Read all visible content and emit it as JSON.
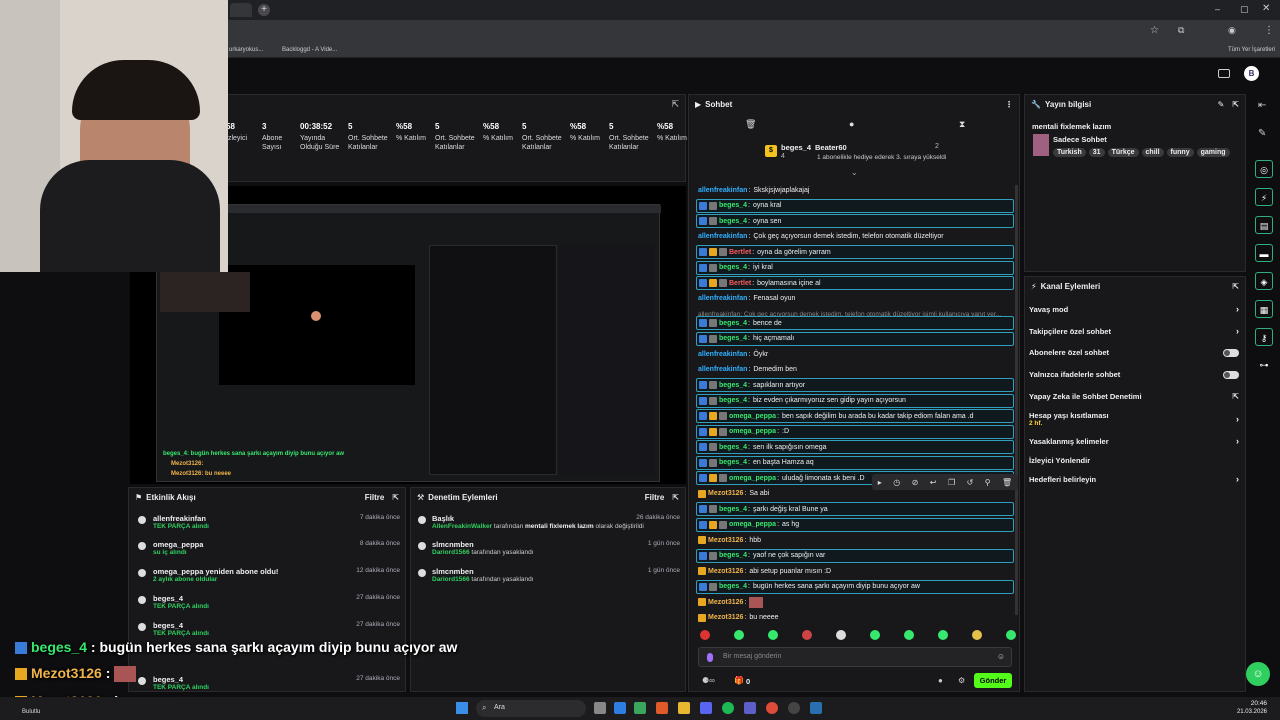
{
  "browser": {
    "tabs": [
      "Backloggd - A Vide..."
    ],
    "bookmark_partial": "Tüm Yer İşaretleri",
    "bookmark_left": "urkaryokus..."
  },
  "stats": [
    {
      "v": "58",
      "l": "İzleyici"
    },
    {
      "v": "3",
      "l": "Abone Sayısı"
    },
    {
      "v": "00:38:52",
      "l": "Yayında Olduğu Süre"
    },
    {
      "v": "5",
      "l": "Ort. Sohbete Katılanlar"
    },
    {
      "v": "%58",
      "l": "% Katılım"
    },
    {
      "v": "5",
      "l": "Ort. Sohbete Katılanlar"
    },
    {
      "v": "%58",
      "l": "% Katılım"
    },
    {
      "v": "5",
      "l": "Ort. Sohbete Katılanlar"
    },
    {
      "v": "%58",
      "l": "% Katılım"
    },
    {
      "v": "5",
      "l": "Ort. Sohbete Katılanlar"
    },
    {
      "v": "%58",
      "l": "% Katılım"
    }
  ],
  "chat": {
    "title": "Sohbet",
    "pinned_user": "beges_4",
    "pinned_count": "4",
    "pinned_gifter": "Beater60",
    "pinned_gift_count": "2",
    "pinned_note": "1 aboneliklе hediye ederek 3. sıraya yükseldi",
    "messages": [
      {
        "u": "allenfreakinfan",
        "m": "Skskjsjwjaplakajaj",
        "c": "#2fb0ff",
        "hl": false,
        "b": []
      },
      {
        "u": "beges_4",
        "m": "oyna kral",
        "c": "#37e86e",
        "hl": true,
        "b": [
          "blue",
          "gray"
        ]
      },
      {
        "u": "beges_4",
        "m": "oyna sen",
        "c": "#37e86e",
        "hl": true,
        "b": [
          "blue",
          "gray"
        ]
      },
      {
        "u": "allenfreakinfan",
        "m": "Çok geç açıyorsun demek istedim, telefon otomatik düzeltiyor",
        "c": "#2fb0ff",
        "hl": false,
        "b": []
      },
      {
        "u": "Bertlet",
        "m": "oyna da görelim yarram",
        "c": "#ff5a5a",
        "hl": true,
        "b": [
          "blue",
          "gold",
          "gray"
        ]
      },
      {
        "u": "beges_4",
        "m": "iyi kral",
        "c": "#37e86e",
        "hl": true,
        "b": [
          "blue",
          "gray"
        ]
      },
      {
        "u": "Bertlet",
        "m": "boylamasına içine al",
        "c": "#ff5a5a",
        "hl": true,
        "b": [
          "blue",
          "gold",
          "gray"
        ]
      },
      {
        "u": "allenfreakinfan",
        "m": "Fenasal oyun",
        "c": "#2fb0ff",
        "hl": false,
        "b": []
      },
      {
        "u": "beges_4",
        "m": "bence de",
        "c": "#37e86e",
        "hl": true,
        "b": [
          "blue",
          "gray"
        ],
        "reply": "allenfreakinfan: Çok geç açıyorsun demek istedim, telefon otomatik düzeltiyor isimli kullanıcıya yanıt ver..."
      },
      {
        "u": "beges_4",
        "m": "hiç açmamalı",
        "c": "#37e86e",
        "hl": true,
        "b": [
          "blue",
          "gray"
        ]
      },
      {
        "u": "allenfreakinfan",
        "m": "Öykr",
        "c": "#2fb0ff",
        "hl": false,
        "b": []
      },
      {
        "u": "allenfreakinfan",
        "m": "Demedim ben",
        "c": "#2fb0ff",
        "hl": false,
        "b": []
      },
      {
        "u": "beges_4",
        "m": "sapıkların artıyor",
        "c": "#37e86e",
        "hl": true,
        "b": [
          "blue",
          "gray"
        ]
      },
      {
        "u": "beges_4",
        "m": "biz evden çıkarmıyoruz sen gidip yayın açıyorsun",
        "c": "#37e86e",
        "hl": true,
        "b": [
          "blue",
          "gray"
        ]
      },
      {
        "u": "omega_peppa",
        "m": "ben sapık değilim bu arada bu kadar takip ediom falan ama .d",
        "c": "#37e86e",
        "hl": true,
        "b": [
          "blue",
          "gold",
          "gray"
        ]
      },
      {
        "u": "omega_peppa",
        "m": ":D",
        "c": "#37e86e",
        "hl": true,
        "b": [
          "blue",
          "gold",
          "gray"
        ]
      },
      {
        "u": "beges_4",
        "m": "sen ilk sapığısın omega",
        "c": "#37e86e",
        "hl": true,
        "b": [
          "blue",
          "gray"
        ]
      },
      {
        "u": "beges_4",
        "m": "en başta Hamza aq",
        "c": "#37e86e",
        "hl": true,
        "b": [
          "blue",
          "gray"
        ]
      },
      {
        "u": "omega_peppa",
        "m": "uludağ limonata sk beni .D",
        "c": "#37e86e",
        "hl": true,
        "b": [
          "blue",
          "gold",
          "gray"
        ]
      },
      {
        "u": "Mezot3126",
        "m": "Sa abi",
        "c": "#f0b44a",
        "hl": false,
        "b": [
          "gold"
        ]
      },
      {
        "u": "beges_4",
        "m": "şarkı değiş kral Bune ya",
        "c": "#37e86e",
        "hl": true,
        "b": [
          "blue",
          "gray"
        ]
      },
      {
        "u": "omega_peppa",
        "m": "as hg",
        "c": "#37e86e",
        "hl": true,
        "b": [
          "blue",
          "gold",
          "gray"
        ]
      },
      {
        "u": "Mezot3126",
        "m": "hbb",
        "c": "#f0b44a",
        "hl": false,
        "b": [
          "gold"
        ]
      },
      {
        "u": "beges_4",
        "m": "yaof ne çok sapığın var",
        "c": "#37e86e",
        "hl": true,
        "b": [
          "blue",
          "gray"
        ]
      },
      {
        "u": "Mezot3126",
        "m": "abi setup puanlar mısın :D",
        "c": "#f0b44a",
        "hl": false,
        "b": [
          "gold"
        ]
      },
      {
        "u": "beges_4",
        "m": "bugün herkes sana şarkı açayım diyip bunu açıyor aw",
        "c": "#37e86e",
        "hl": true,
        "b": [
          "blue",
          "gray"
        ]
      },
      {
        "u": "Mezot3126",
        "m": "",
        "c": "#f0b44a",
        "hl": false,
        "b": [
          "gold"
        ],
        "img": true
      },
      {
        "u": "Mezot3126",
        "m": "bu neeee",
        "c": "#f0b44a",
        "hl": false,
        "b": [
          "gold"
        ]
      }
    ],
    "input_placeholder": "Bir mesaj gönderin",
    "points": "0",
    "send_label": "Gönder"
  },
  "stream_info": {
    "title": "Yayın bilgisi",
    "stream_title": "mentali fixlemek lazım",
    "category": "Sadece Sohbet",
    "tags": [
      "Turkish",
      "31",
      "Türkçe",
      "chill",
      "funny",
      "gaming"
    ]
  },
  "channel_actions": {
    "title": "Kanal Eylemleri",
    "items": [
      {
        "label": "Yavaş mod",
        "ctl": "arrow"
      },
      {
        "label": "Takipçilere özel sohbet",
        "ctl": "arrow"
      },
      {
        "label": "Abonelere özel sohbet",
        "ctl": "toggle"
      },
      {
        "label": "Yalnızca ifadelerle sohbet",
        "ctl": "toggle"
      },
      {
        "label": "Yapay Zeka ile Sohbet Denetimi",
        "ctl": "ext"
      },
      {
        "label": "Hesap yaşı kısıtlaması",
        "ctl": "arrow",
        "sub": "2 hf."
      },
      {
        "label": "Yasaklanmış kelimeler",
        "ctl": "arrow"
      },
      {
        "label": "İzleyici Yönlendir",
        "ctl": "none"
      },
      {
        "label": "Hedefleri belirleyin",
        "ctl": "arrow"
      }
    ]
  },
  "activity": {
    "title": "Etkinlik Akışı",
    "filter": "Filtre",
    "items": [
      {
        "n": "allenfreakinfan",
        "s": "TEK PARÇA alındı",
        "t": "7 dakika önce"
      },
      {
        "n": "omega_peppa",
        "s": "su iç alındı",
        "t": "8 dakika önce"
      },
      {
        "n": "omega_peppa yeniden abone oldu!",
        "s": "2 aylık abone oldular",
        "t": "12 dakika önce"
      },
      {
        "n": "beges_4",
        "s": "TEK PARÇA alındı",
        "t": "27 dakika önce"
      },
      {
        "n": "beges_4",
        "s": "TEK PARÇA alındı",
        "t": "27 dakika önce"
      },
      {
        "n": "beges_4",
        "s": "TEK PARÇA alındı",
        "t": "27 dakika önce"
      }
    ]
  },
  "moderation": {
    "title": "Denetim Eylemleri",
    "filter": "Filtre",
    "items": [
      {
        "h": "Başlık",
        "a": "AllenFreakinWalker",
        "m": "tarafından",
        "x": "mentali fixlemek lazım",
        "y": "olarak değiştirildi",
        "t": "26 dakika önce"
      },
      {
        "h": "slmcnmben",
        "a": "Dariord1566",
        "m": "tarafından yasaklandı",
        "x": "",
        "y": "",
        "t": "1 gün önce"
      },
      {
        "h": "slmcnmben",
        "a": "Dariord1566",
        "m": "tarafından yasaklandı",
        "x": "",
        "y": "",
        "t": "1 gün önce"
      }
    ]
  },
  "overlay": [
    {
      "u": "beges_4",
      "m": " : bugün herkes sana şarkı açayım diyip bunu açıyor aw",
      "c": "#37e86e"
    },
    {
      "u": "Mezot3126",
      "m": " : ",
      "c": "#f0b44a"
    },
    {
      "u": "Mezot3126",
      "m": " : bu neeee",
      "c": "#f0b44a"
    }
  ],
  "taskbar": {
    "search": "Ara",
    "time": "20:46",
    "date": "21.03.2026",
    "weather": "Bulutlu"
  },
  "preview": {
    "chat1": "beges_4: bugün herkes sana şarkı açayım diyip bunu açıyor aw",
    "chat2": "Mezot3126:",
    "chat3": "Mezot3126: bu neeee"
  }
}
